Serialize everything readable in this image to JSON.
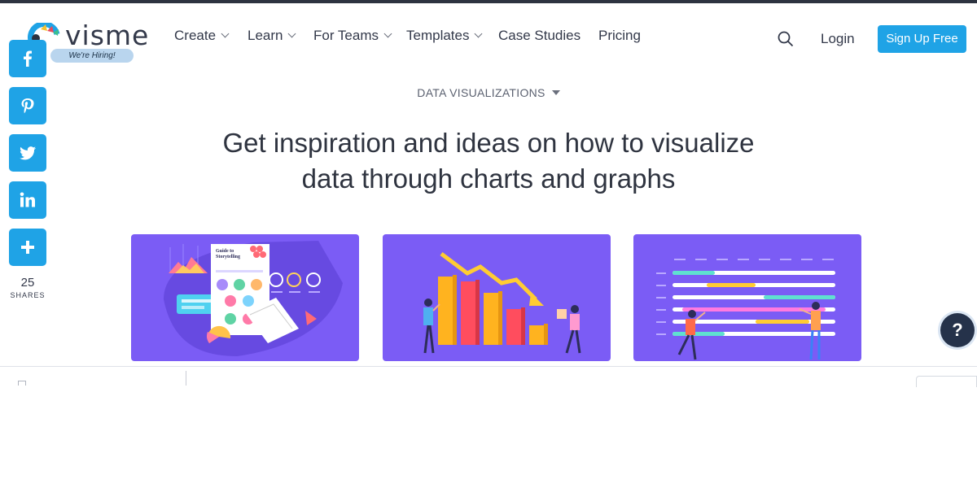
{
  "brand": {
    "name": "visme",
    "hiring_badge": "We're Hiring!"
  },
  "nav": {
    "items": [
      {
        "label": "Create",
        "has_dropdown": true
      },
      {
        "label": "Learn",
        "has_dropdown": true
      },
      {
        "label": "For Teams",
        "has_dropdown": true
      },
      {
        "label": "Templates",
        "has_dropdown": true
      },
      {
        "label": "Case Studies",
        "has_dropdown": false
      },
      {
        "label": "Pricing",
        "has_dropdown": false
      }
    ],
    "login": "Login",
    "signup": "Sign Up Free",
    "search_icon": "search-icon"
  },
  "share": {
    "buttons": [
      "facebook-icon",
      "pinterest-icon",
      "twitter-icon",
      "linkedin-icon",
      "plus-icon"
    ],
    "count": "25",
    "label": "SHARES"
  },
  "page": {
    "category": "DATA VISUALIZATIONS",
    "headline_line1": "Get inspiration and ideas on how to visualize",
    "headline_line2": "data through charts and graphs"
  },
  "cards": [
    {
      "illustration": "guide-to-storytelling",
      "book_title": "Guide to Storytelling"
    },
    {
      "illustration": "declining-bar-chart"
    },
    {
      "illustration": "gantt-progress-chart"
    }
  ],
  "help": {
    "label": "?"
  },
  "colors": {
    "accent": "#1fa3e6",
    "card_bg": "#7b5cf5",
    "text": "#33394a"
  }
}
